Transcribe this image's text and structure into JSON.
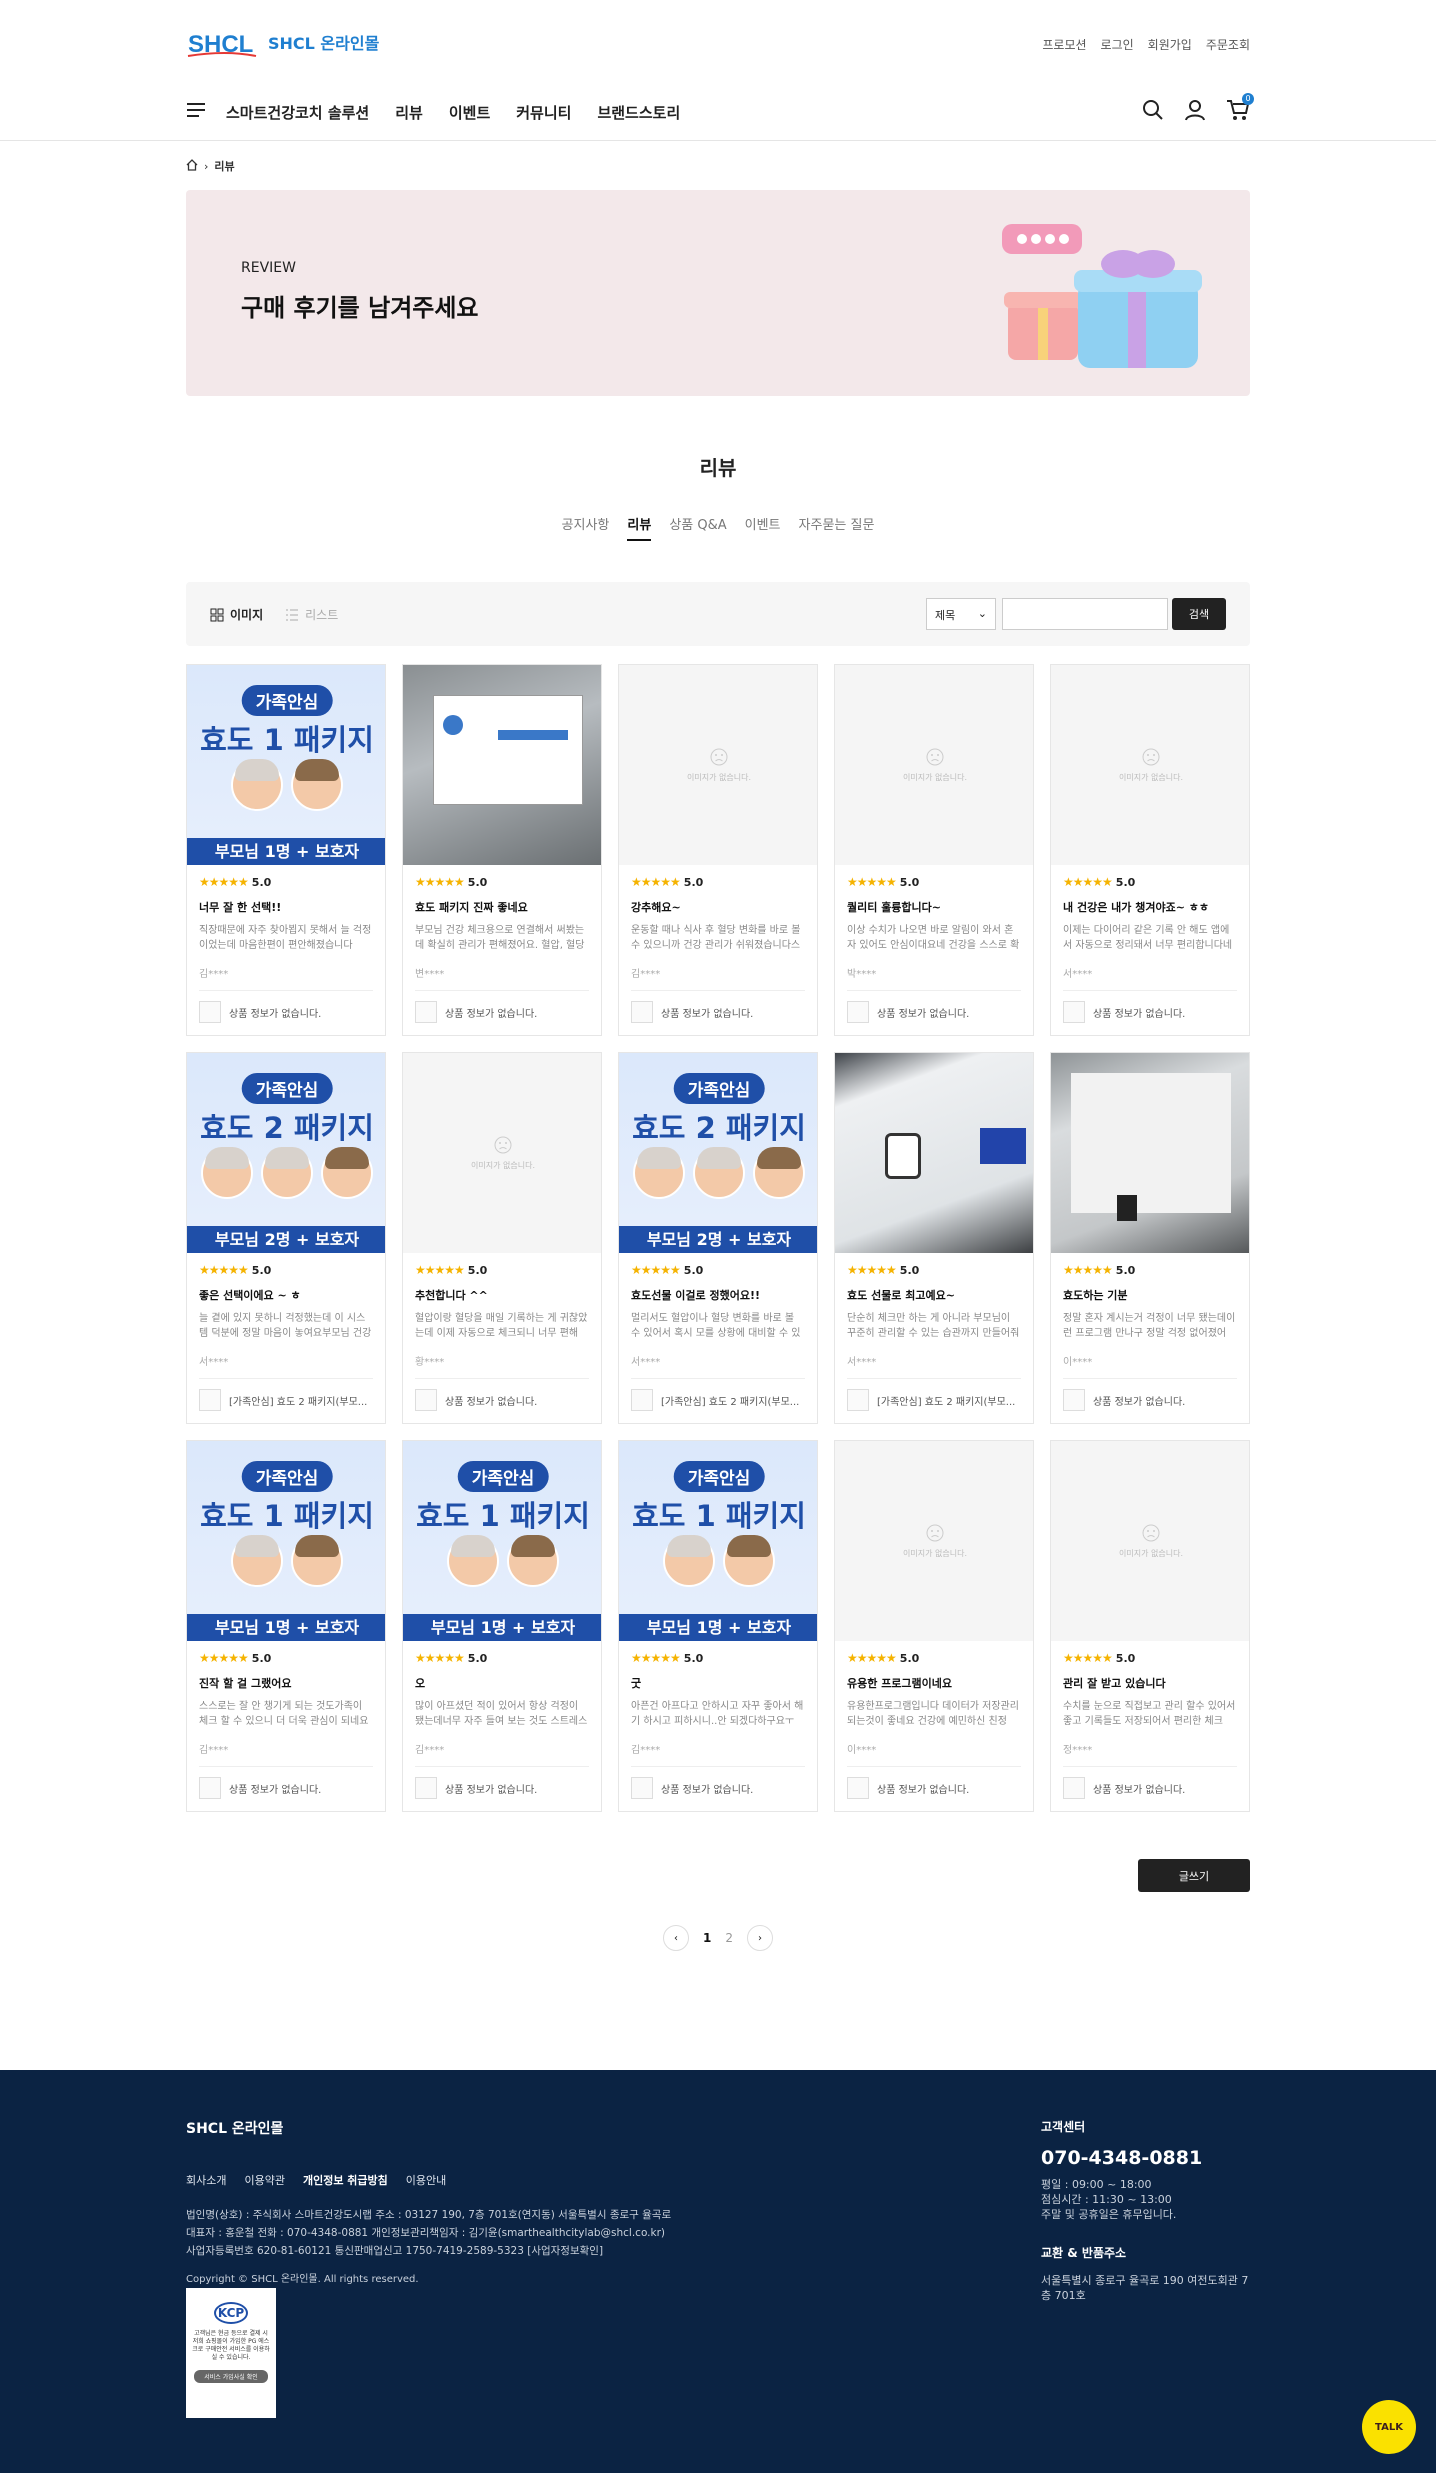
{
  "header": {
    "logo_text": "SHCL 온라인몰",
    "top_links": [
      "프로모션",
      "로그인",
      "회원가입",
      "주문조회"
    ],
    "menu": [
      "스마트건강코치 솔루션",
      "리뷰",
      "이벤트",
      "커뮤니티",
      "브랜드스토리"
    ],
    "cart_count": "0"
  },
  "breadcrumb": {
    "current": "리뷰"
  },
  "banner": {
    "sub": "REVIEW",
    "title": "구매 후기를 남겨주세요"
  },
  "page": {
    "title": "리뷰",
    "tabs": [
      "공지사항",
      "리뷰",
      "상품 Q&A",
      "이벤트",
      "자주묻는 질문"
    ],
    "active_tab": "리뷰"
  },
  "toolbar": {
    "image_view": "이미지",
    "list_view": "리스트",
    "select_value": "제목",
    "search_label": "검색"
  },
  "noimg_text": "이미지가 없습니다.",
  "reviews": [
    {
      "thumb": "pkg1",
      "badge": "가족안심",
      "big": "효도 1 패키지",
      "strip": "부모님 1명 + 보호자",
      "rating": "5.0",
      "title": "너무 잘 한 선택!!",
      "body": "직장때문에 자주 찾아뵙지 못해서 늘 걱정이었는데 마음한편이 편안해졌습니다 들...",
      "author": "김****",
      "product": "상품 정보가 없습니다."
    },
    {
      "thumb": "photo1",
      "rating": "5.0",
      "title": "효도 패키지 진짜 좋네요",
      "body": "부모님 건강 체크용으로 연결해서 써봤는데 확실히 관리가 편해졌어요. 혈압, 혈당 같...",
      "author": "변****",
      "product": "상품 정보가 없습니다."
    },
    {
      "thumb": "noimg",
      "rating": "5.0",
      "title": "강추해요~",
      "body": "운동할 때나 식사 후 혈당 변화를 바로 볼 수 있으니까 건강 관리가 쉬워졌습니다스스...",
      "author": "김****",
      "product": "상품 정보가 없습니다."
    },
    {
      "thumb": "noimg",
      "rating": "5.0",
      "title": "퀄리티 훌륭합니다~",
      "body": "이상 수치가 나오면 바로 알림이 와서 혼자 있어도 안심이대요네 건강을 스스로 확인할...",
      "author": "박****",
      "product": "상품 정보가 없습니다."
    },
    {
      "thumb": "noimg",
      "rating": "5.0",
      "title": "내 건강은 내가 챙겨야죠~ ㅎㅎ",
      "body": "이제는 다이어리 같은 기록 안 해도 앱에서 자동으로 정리돼서 너무 편리합니다네 건...",
      "author": "서****",
      "product": "상품 정보가 없습니다."
    },
    {
      "thumb": "pkg2",
      "badge": "가족안심",
      "big": "효도 2 패키지",
      "strip": "부모님 2명 + 보호자",
      "rating": "5.0",
      "title": "좋은 선택이에요 ~ ㅎ",
      "body": "늘 곁에 있지 못하니 걱정했는데 이 시스템 덕분에 정말 마음이 놓여요부모님 건강 상...",
      "author": "서****",
      "product": "[가족안심] 효도 2 패키지(부모..."
    },
    {
      "thumb": "noimg",
      "rating": "5.0",
      "title": "추천합니다 ^^",
      "body": "혈압이랑 혈당을 매일 기록하는 게 귀찮았는데 이제 자동으로 체크되니 너무 편해요...",
      "author": "황****",
      "product": "상품 정보가 없습니다."
    },
    {
      "thumb": "pkg2",
      "badge": "가족안심",
      "big": "효도 2 패키지",
      "strip": "부모님 2명 + 보호자",
      "rating": "5.0",
      "title": "효도선물 이걸로 정했어요!!",
      "body": "멀리서도 혈압이나 혈당 변화를 바로 볼 수 있어서 혹시 모를 상황에 대비할 수 있는 ...",
      "author": "서****",
      "product": "[가족안심] 효도 2 패키지(부모..."
    },
    {
      "thumb": "photo2",
      "rating": "5.0",
      "title": "효도 선물로 최고예요~",
      "body": "단순히 체크만 하는 게 아니라 부모님이 꾸준히 관리할 수 있는 습관까지 만들어줘서...",
      "author": "서****",
      "product": "[가족안심] 효도 2 패키지(부모..."
    },
    {
      "thumb": "photo3",
      "rating": "5.0",
      "title": "효도하는 기분",
      "body": "정말 혼자 계시는거 걱정이 너무 됐는데이런 프로그램 만나구 정말 걱정 없어졌어요...",
      "author": "이****",
      "product": "상품 정보가 없습니다."
    },
    {
      "thumb": "pkg1",
      "badge": "가족안심",
      "big": "효도 1 패키지",
      "strip": "부모님 1명 + 보호자",
      "rating": "5.0",
      "title": "진작 할 걸 그랬어요",
      "body": "스스로는 잘 안 챙기게 되는 것도가족이 체크 할 수 있으니 더 더욱 관심이 되네요능...",
      "author": "김****",
      "product": "상품 정보가 없습니다."
    },
    {
      "thumb": "pkg1",
      "badge": "가족안심",
      "big": "효도 1 패키지",
      "strip": "부모님 1명 + 보호자",
      "rating": "5.0",
      "title": "오",
      "body": "많이 아프셨던 적이 있어서 항상 걱정이 됐는데너무 자주 들여 보는 것도 스트레스 ...",
      "author": "김****",
      "product": "상품 정보가 없습니다."
    },
    {
      "thumb": "pkg1",
      "badge": "가족안심",
      "big": "효도 1 패키지",
      "strip": "부모님 1명 + 보호자",
      "rating": "5.0",
      "title": "굿",
      "body": "아픈건 아프다고 안하시고 자꾸 좋아서 해 기 하시고 피하시니..안 되겠다하구요ㅜㅜ...",
      "author": "김****",
      "product": "상품 정보가 없습니다."
    },
    {
      "thumb": "noimg",
      "rating": "5.0",
      "title": "유용한 프로그램이네요",
      "body": "유용한프로그램입니다 데이터가 저장관리되는것이 좋네요 건강에 예민하신 친정어...",
      "author": "이****",
      "product": "상품 정보가 없습니다."
    },
    {
      "thumb": "noimg",
      "rating": "5.0",
      "title": "관리 잘 받고 있습니다",
      "body": "수치를 눈으로 직접보고 관리 할수 있어서 좋고 기록들도 저장되어서 편리한 체크하...",
      "author": "정****",
      "product": "상품 정보가 없습니다."
    }
  ],
  "write_label": "글쓰기",
  "pager": {
    "pages": [
      "1",
      "2"
    ],
    "current": "1",
    "prev": "‹",
    "next": "›"
  },
  "footer": {
    "logo": "SHCL 온라인몰",
    "links": [
      "회사소개",
      "이용약관",
      "개인정보 취급방침",
      "이용안내"
    ],
    "company_lines": [
      "법인명(상호) : 주식회사 스마트건강도시랩      주소 : 03127 190, 7층 701호(연지동) 서울특별시 종로구 율곡로",
      "대표자 : 홍운철      전화 : 070-4348-0881      개인정보관리책임자 : 김기윤(smarthealthcitylab@shcl.co.kr)",
      "사업자등록번호 620-81-60121      통신판매업신고 1750-7419-2589-5323 [사업자정보확인]"
    ],
    "copyright": "Copyright © SHCL 온라인몰. All rights reserved.",
    "kcp_title": "KCP",
    "kcp_text": "고객님은 현금 등으로 결제 시 저희 쇼핑몰이 가입한 PG 에스크로 구매안전 서비스를 이용하실 수 있습니다.",
    "kcp_btn": "서비스 가입사실 확인",
    "cs_title": "고객센터",
    "cs_tel": "070-4348-0881",
    "cs_hours": [
      "평일 : 09:00 ~ 18:00",
      "점심시간 : 11:30 ~ 13:00",
      "주말 및 공휴일은 휴무입니다."
    ],
    "return_title": "교환 & 반품주소",
    "return_addr": "서울특별시 종로구 율곡로 190 여전도회관 7층 701호"
  },
  "talk_label": "TALK"
}
